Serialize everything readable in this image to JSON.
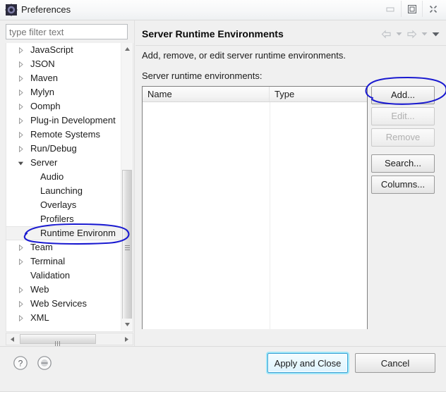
{
  "window": {
    "title": "Preferences",
    "icon": "preferences-gear-icon",
    "controls": [
      {
        "name": "minimize-button",
        "icon": "minimize-icon"
      },
      {
        "name": "maximize-button",
        "icon": "restore-icon"
      },
      {
        "name": "close-button",
        "icon": "close-icon"
      }
    ]
  },
  "filter": {
    "value": "",
    "placeholder": "type filter text"
  },
  "tree": {
    "items": [
      {
        "label": "JavaScript",
        "level": 0,
        "expander": "collapsed",
        "selected": false
      },
      {
        "label": "JSON",
        "level": 0,
        "expander": "collapsed",
        "selected": false
      },
      {
        "label": "Maven",
        "level": 0,
        "expander": "collapsed",
        "selected": false
      },
      {
        "label": "Mylyn",
        "level": 0,
        "expander": "collapsed",
        "selected": false
      },
      {
        "label": "Oomph",
        "level": 0,
        "expander": "collapsed",
        "selected": false
      },
      {
        "label": "Plug-in Development",
        "level": 0,
        "expander": "collapsed",
        "selected": false
      },
      {
        "label": "Remote Systems",
        "level": 0,
        "expander": "collapsed",
        "selected": false
      },
      {
        "label": "Run/Debug",
        "level": 0,
        "expander": "collapsed",
        "selected": false
      },
      {
        "label": "Server",
        "level": 0,
        "expander": "expanded",
        "selected": false
      },
      {
        "label": "Audio",
        "level": 1,
        "expander": "none",
        "selected": false
      },
      {
        "label": "Launching",
        "level": 1,
        "expander": "none",
        "selected": false
      },
      {
        "label": "Overlays",
        "level": 1,
        "expander": "none",
        "selected": false
      },
      {
        "label": "Profilers",
        "level": 1,
        "expander": "none",
        "selected": false
      },
      {
        "label": "Runtime Environm",
        "level": 1,
        "expander": "none",
        "selected": true
      },
      {
        "label": "Team",
        "level": 0,
        "expander": "collapsed",
        "selected": false
      },
      {
        "label": "Terminal",
        "level": 0,
        "expander": "collapsed",
        "selected": false
      },
      {
        "label": "Validation",
        "level": 0,
        "expander": "none",
        "selected": false
      },
      {
        "label": "Web",
        "level": 0,
        "expander": "collapsed",
        "selected": false
      },
      {
        "label": "Web Services",
        "level": 0,
        "expander": "collapsed",
        "selected": false
      },
      {
        "label": "XML",
        "level": 0,
        "expander": "collapsed",
        "selected": false
      }
    ]
  },
  "page": {
    "title": "Server Runtime Environments",
    "description": "Add, remove, or edit server runtime environments.",
    "list_label": "Server runtime environments:",
    "nav": [
      {
        "name": "back-button",
        "icon": "arrow-left-icon",
        "enabled": false
      },
      {
        "name": "back-history-dropdown",
        "icon": "caret-down-icon",
        "enabled": false
      },
      {
        "name": "forward-button",
        "icon": "arrow-right-icon",
        "enabled": false
      },
      {
        "name": "forward-history-dropdown",
        "icon": "caret-down-icon",
        "enabled": false
      },
      {
        "name": "view-menu-button",
        "icon": "caret-down-filled-icon",
        "enabled": true
      }
    ]
  },
  "table": {
    "columns": [
      "Name",
      "Type"
    ],
    "rows": []
  },
  "side_buttons": [
    {
      "label": "Add...",
      "name": "add-button",
      "enabled": true,
      "gap": false
    },
    {
      "label": "Edit...",
      "name": "edit-button",
      "enabled": false,
      "gap": false
    },
    {
      "label": "Remove",
      "name": "remove-button",
      "enabled": false,
      "gap": false
    },
    {
      "label": "Search...",
      "name": "search-button",
      "enabled": true,
      "gap": true
    },
    {
      "label": "Columns...",
      "name": "columns-button",
      "enabled": true,
      "gap": false
    }
  ],
  "footer": {
    "help_icon": "help-question-icon",
    "shell_icon": "restore-defaults-icon",
    "buttons": [
      {
        "label": "Apply and Close",
        "name": "apply-and-close-button",
        "focused": true
      },
      {
        "label": "Cancel",
        "name": "cancel-button",
        "focused": false
      }
    ]
  },
  "annotations": {
    "ink_color": "#1a1ad0",
    "marks": [
      {
        "name": "ink-circle-runtime-environments",
        "target": "tree-item-runtime-environm"
      },
      {
        "name": "ink-circle-add-button",
        "target": "add-button"
      }
    ]
  }
}
